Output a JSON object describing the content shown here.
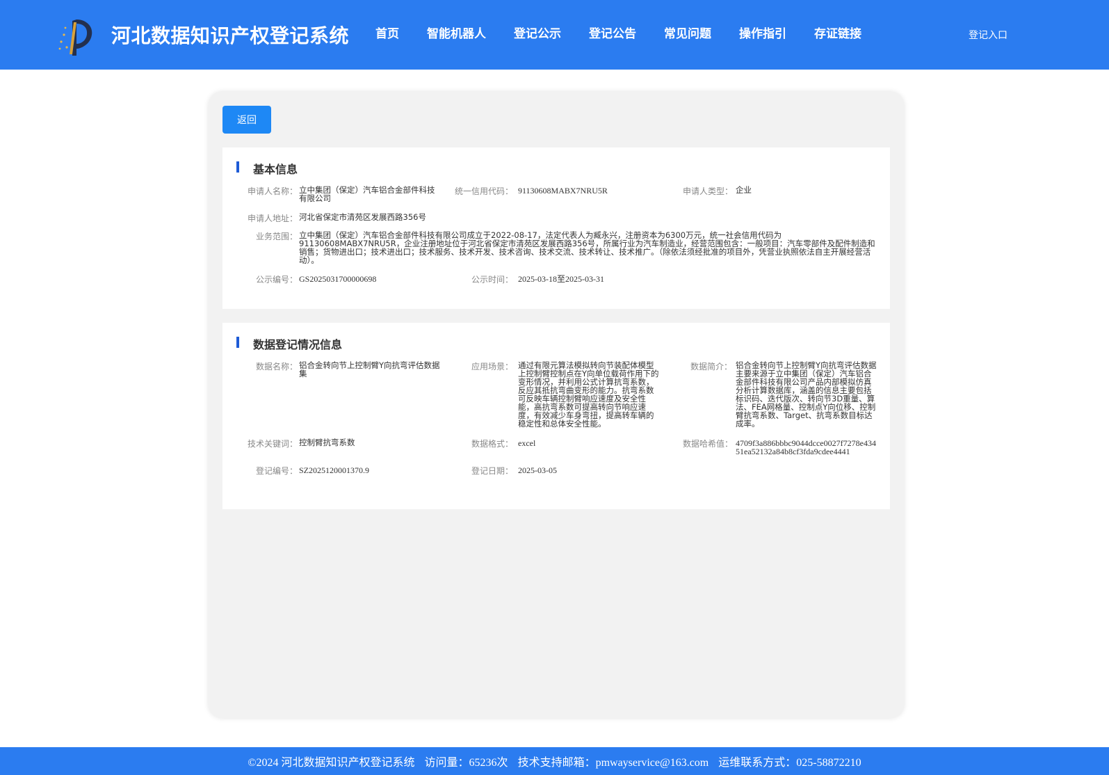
{
  "header": {
    "title": "河北数据知识产权登记系统",
    "nav": [
      "首页",
      "智能机器人",
      "登记公示",
      "登记公告",
      "常见问题",
      "操作指引",
      "存证链接"
    ],
    "login": "登记入口"
  },
  "panel": {
    "back": "返回"
  },
  "basic": {
    "title": "基本信息",
    "applicant_name_label": "申请人名称：",
    "applicant_name": "立中集团（保定）汽车铝合金部件科技有限公司",
    "credit_code_label": "统一信用代码：",
    "credit_code": "91130608MABX7NRU5R",
    "applicant_type_label": "申请人类型：",
    "applicant_type": "企业",
    "address_label": "申请人地址：",
    "address": "河北省保定市清苑区发展西路356号",
    "business_label": "业务范围：",
    "business": "立中集团（保定）汽车铝合金部件科技有限公司成立于2022-08-17，法定代表人为臧永兴，注册资本为6300万元，统一社会信用代码为91130608MABX7NRU5R，企业注册地址位于河北省保定市清苑区发展西路356号，所属行业为汽车制造业，经营范围包含：一般项目：汽车零部件及配件制造和销售；货物进出口；技术进出口；技术服务、技术开发、技术咨询、技术交流、技术转让、技术推广。（除依法须经批准的项目外，凭营业执照依法自主开展经营活动）。",
    "pub_no_label": "公示编号：",
    "pub_no": "GS2025031700000698",
    "pub_time_label": "公示时间：",
    "pub_time": "2025-03-18至2025-03-31"
  },
  "data_reg": {
    "title": "数据登记情况信息",
    "data_name_label": "数据名称：",
    "data_name": "铝合金转向节上控制臂Y向抗弯评估数据集",
    "scene_label": "应用场景：",
    "scene": "通过有限元算法模拟转向节装配体模型上控制臂控制点在Y向单位载荷作用下的变形情况，并利用公式计算抗弯系数，反应其抵抗弯曲变形的能力。抗弯系数可反映车辆控制臂响应速度及安全性能，高抗弯系数可提高转向节响应速度，有效减少车身弯扭，提高转车辆的稳定性和总体安全性能。",
    "intro_label": "数据简介：",
    "intro": "铝合金转向节上控制臂Y向抗弯评估数据主要来源于立中集团（保定）汽车铝合金部件科技有限公司产品内部模拟仿真分析计算数据库，涵盖的信息主要包括标识码、迭代版次、转向节3D重量、算法、FEA网格量、控制点Y向位移、控制臂抗弯系数、Target、抗弯系数目标达成率。",
    "keywords_label": "技术关键词：",
    "keywords": "控制臂抗弯系数",
    "format_label": "数据格式：",
    "format": "excel",
    "hash_label": "数据哈希值：",
    "hash": "4709f3a886bbbc9044dcce0027f7278e43451ea52132a84b8cf3fda9cdee4441",
    "reg_no_label": "登记编号：",
    "reg_no": "SZ2025120001370.9",
    "reg_date_label": "登记日期：",
    "reg_date": "2025-03-05"
  },
  "footer": {
    "copyright": "©2024 河北数据知识产权登记系统",
    "visits": "访问量：65236次",
    "email": "技术支持邮箱：pmwayservice@163.com",
    "phone": "运维联系方式：025-58872210"
  }
}
